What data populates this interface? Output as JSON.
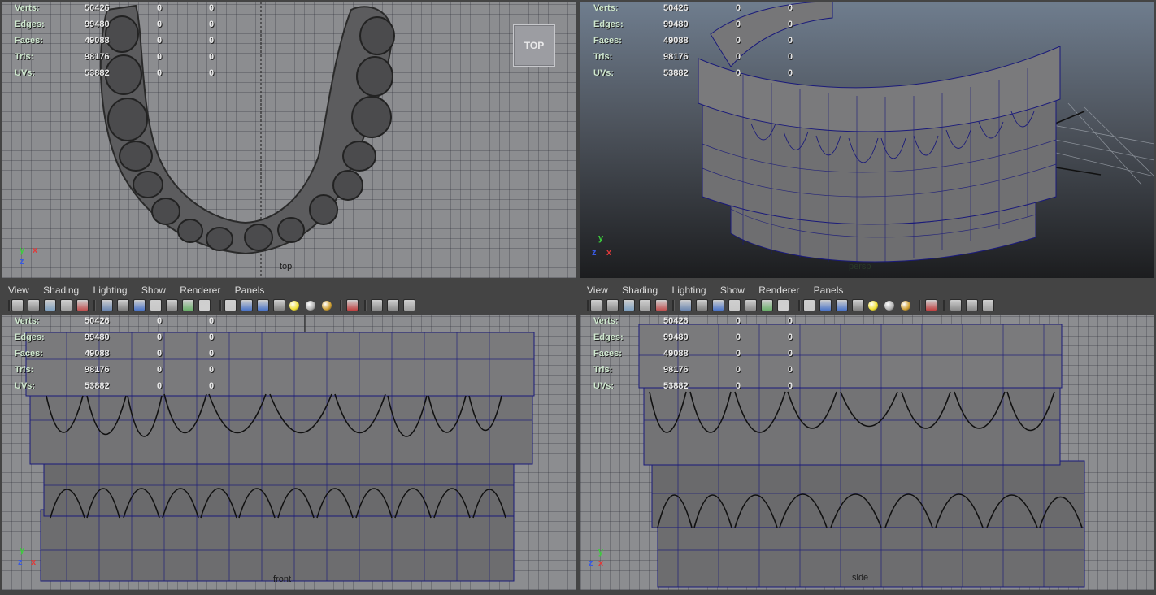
{
  "stats": {
    "rows": [
      {
        "label": "Verts:",
        "v1": "50426",
        "v2": "0",
        "v3": "0"
      },
      {
        "label": "Edges:",
        "v1": "99480",
        "v2": "0",
        "v3": "0"
      },
      {
        "label": "Faces:",
        "v1": "49088",
        "v2": "0",
        "v3": "0"
      },
      {
        "label": "Tris:",
        "v1": "98176",
        "v2": "0",
        "v3": "0"
      },
      {
        "label": "UVs:",
        "v1": "53882",
        "v2": "0",
        "v3": "0"
      }
    ]
  },
  "menu": {
    "items": [
      "View",
      "Shading",
      "Lighting",
      "Show",
      "Renderer",
      "Panels"
    ]
  },
  "viewports": {
    "top": {
      "camera_label": "top",
      "view_cube": "TOP"
    },
    "persp": {
      "camera_label": "persp"
    },
    "front": {
      "camera_label": "front"
    },
    "side": {
      "camera_label": "side"
    }
  },
  "axes": {
    "y": "y",
    "x": "x",
    "z": "z"
  },
  "toolbar_icons": [
    "camera-attributes-icon",
    "camera-bookmark-icon",
    "image-plane-icon",
    "two-d-pan-icon",
    "grease-pencil-icon",
    "grid-icon",
    "film-gate-icon",
    "resolution-gate-icon",
    "gate-mask-icon",
    "field-chart-icon",
    "safe-action-icon",
    "safe-title-icon",
    "wireframe-icon",
    "smooth-shade-icon",
    "wireframe-on-shaded-icon",
    "textured-icon",
    "default-light-icon",
    "all-lights-icon",
    "shadows-icon",
    "isolate-select-icon",
    "xray-icon",
    "xray-joints-icon",
    "xray-components-icon"
  ],
  "colors": {
    "ui_bg": "#444444",
    "viewport_grey": "#8c8d90",
    "persp_top": "#6f7d8e",
    "persp_bottom": "#1c1d1f",
    "mesh_fill": "#6e6e70",
    "wire": "#1a1a7a",
    "axis_x": "#e03a3a",
    "axis_y": "#3ccf3c",
    "axis_z": "#3a5ae0",
    "stat_label": "#cfe8cf"
  }
}
